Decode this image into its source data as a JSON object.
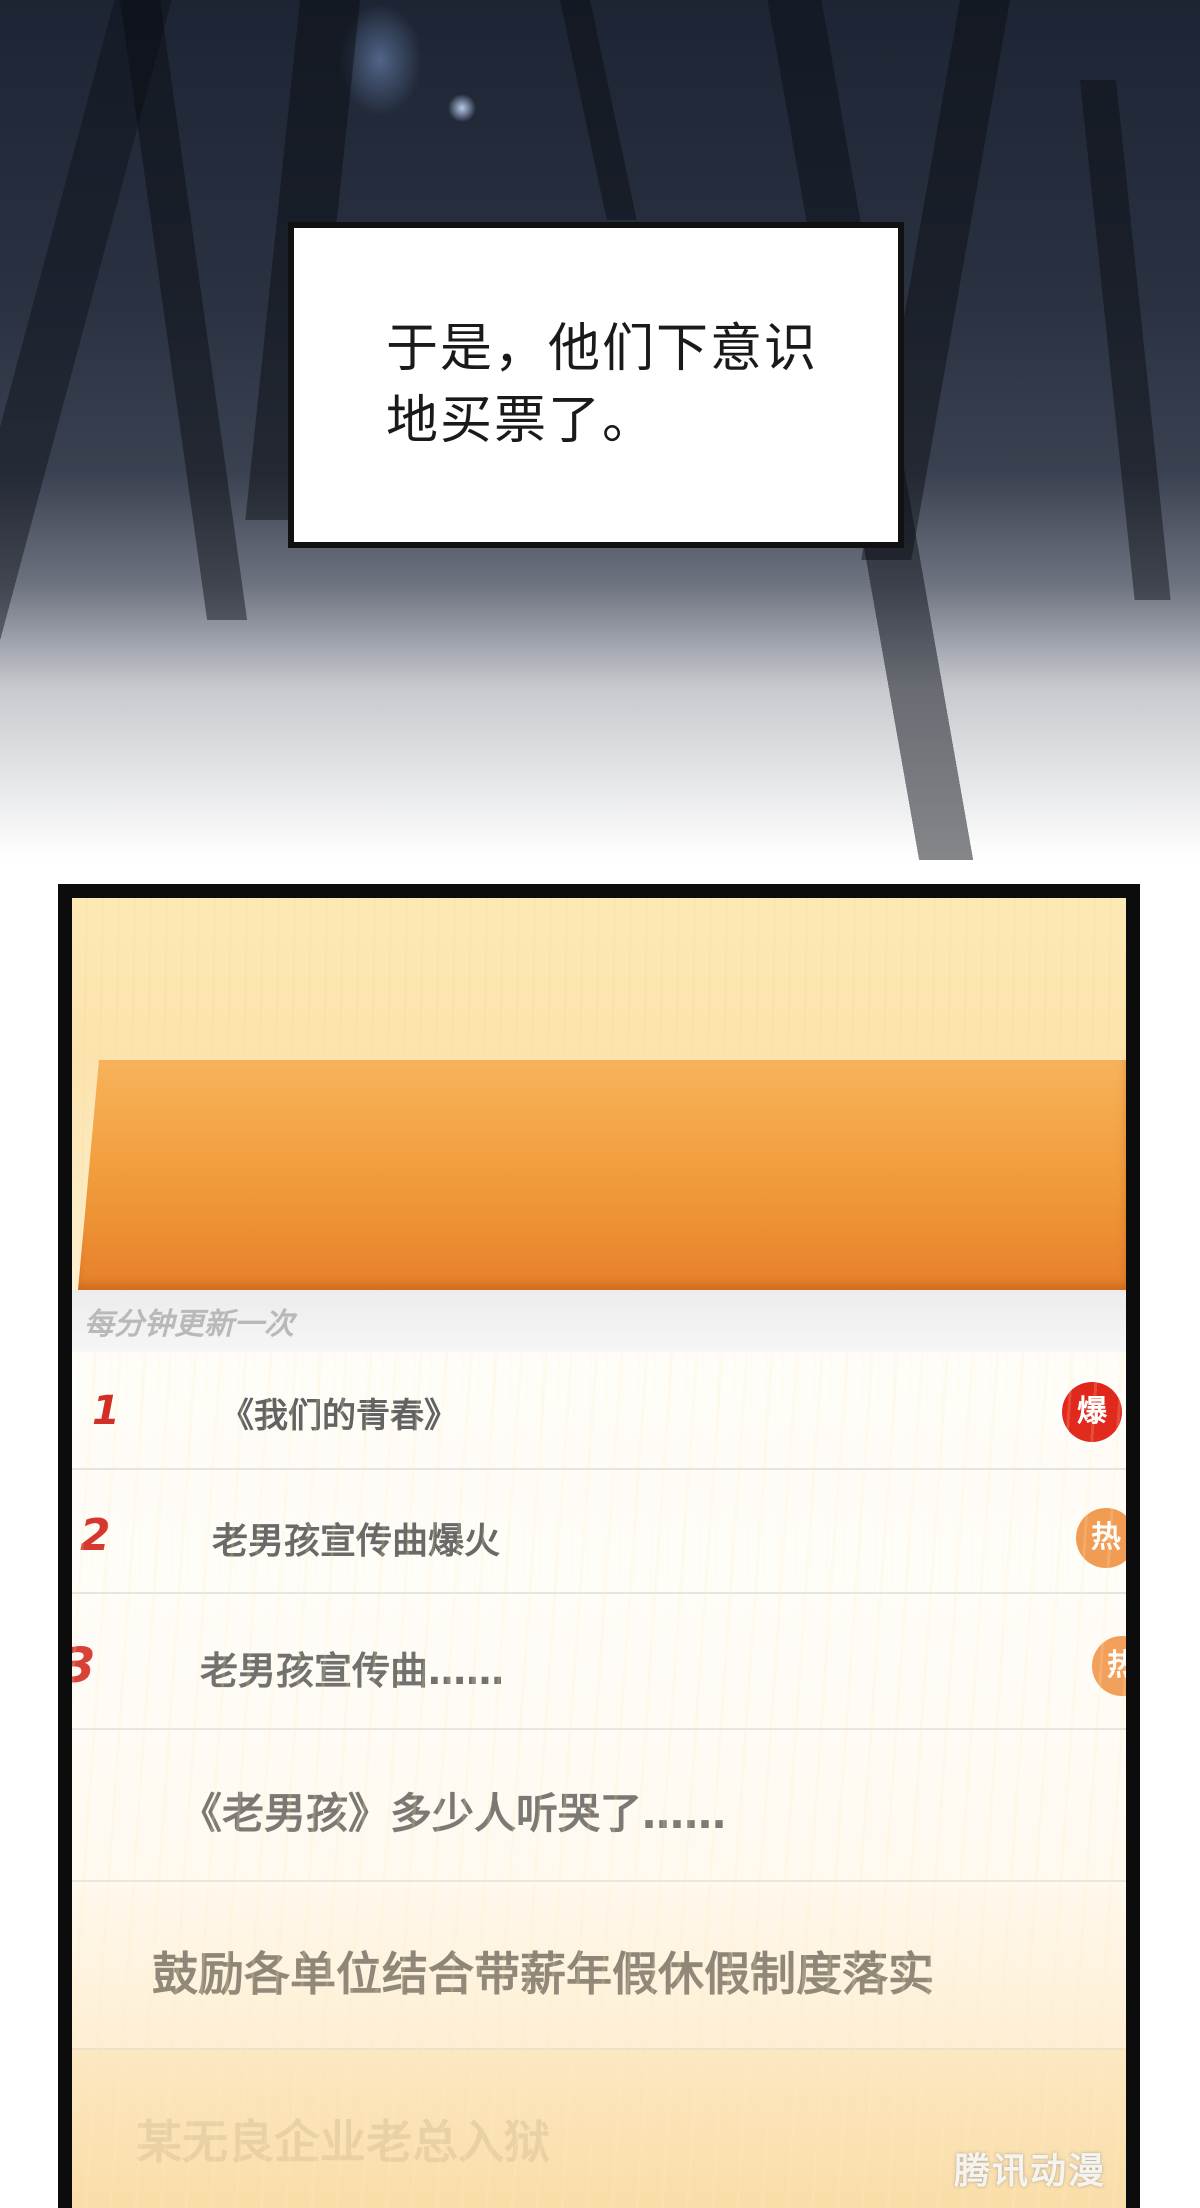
{
  "caption": {
    "line1": "于是，他们下意识",
    "line2": "地买票了。"
  },
  "hot_list": {
    "update_note": "每分钟更新一次",
    "items": [
      {
        "rank": "1",
        "title": "《我们的青春》",
        "badge": "爆"
      },
      {
        "rank": "2",
        "title": "老男孩宣传曲爆火",
        "badge": "热"
      },
      {
        "rank": "3",
        "title": "老男孩宣传曲……",
        "badge": "热"
      },
      {
        "rank": "",
        "title": "《老男孩》多少人听哭了……",
        "badge": ""
      },
      {
        "rank": "",
        "title": "鼓励各单位结合带薪年假休假制度落实",
        "badge": ""
      },
      {
        "rank": "",
        "title": "某无良企业老总入狱",
        "badge": ""
      }
    ]
  },
  "watermark": "腾讯动漫",
  "colors": {
    "rank_red": "#d22a22",
    "badge_hot": "#e02418",
    "badge_warm": "#f0954a",
    "header_orange": "#f09a3a"
  }
}
